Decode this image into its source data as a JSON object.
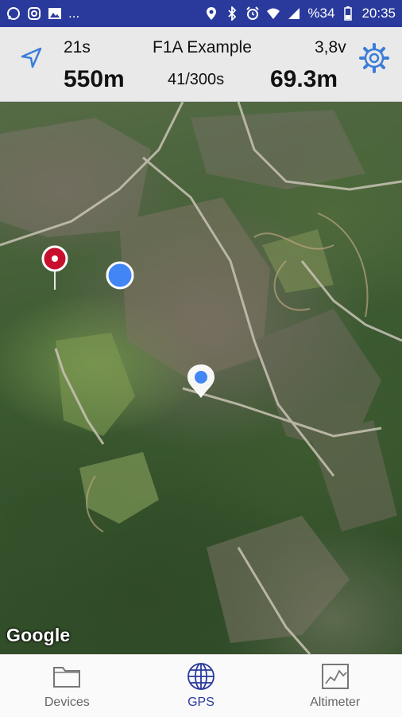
{
  "status_bar": {
    "battery": "%34",
    "time": "20:35",
    "icons_left": [
      "whatsapp-icon",
      "instagram-icon",
      "gallery-icon"
    ],
    "more": "...",
    "icons_right": [
      "location-icon",
      "bluetooth-icon",
      "alarm-icon",
      "wifi-icon",
      "signal-icon",
      "battery-icon"
    ]
  },
  "header": {
    "time": "21s",
    "title": "F1A Example",
    "voltage": "3,8v",
    "distance": "550m",
    "counter": "41/300s",
    "altitude": "69.3m"
  },
  "map": {
    "attribution": "Google"
  },
  "bottom_nav": {
    "items": [
      {
        "label": "Devices",
        "icon": "folder-icon"
      },
      {
        "label": "GPS",
        "icon": "globe-icon",
        "active": true
      },
      {
        "label": "Altimeter",
        "icon": "chart-icon"
      }
    ]
  },
  "colors": {
    "status_bar": "#2a3a9c",
    "accent": "#2a3a9c",
    "pin_red": "#c8102e",
    "marker_blue": "#4285f4"
  }
}
